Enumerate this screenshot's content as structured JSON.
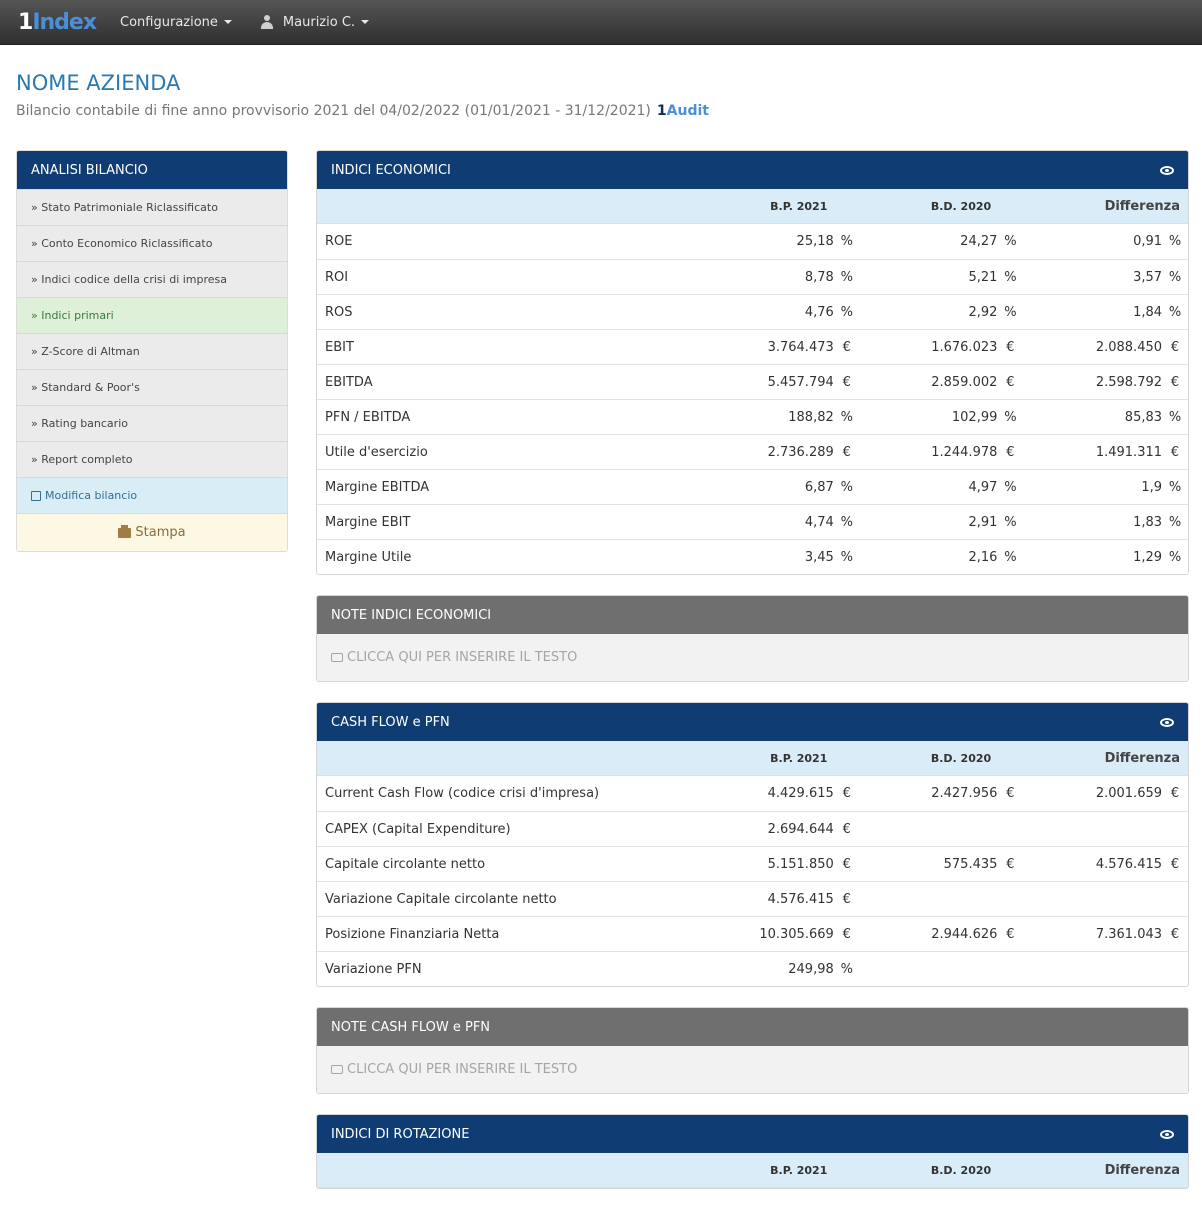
{
  "navbar": {
    "brand_one": "1",
    "brand_word": "Index",
    "config_label": "Configurazione",
    "user_label": "Maurizio C."
  },
  "header": {
    "company": "NOME AZIENDA",
    "subtitle": "Bilancio contabile di fine anno provvisorio 2021 del 04/02/2022 (01/01/2021 - 31/12/2021)",
    "audit_one": "1",
    "audit_word": "Audit"
  },
  "sidebar": {
    "title": "ANALISI BILANCIO",
    "items": [
      "» Stato Patrimoniale Riclassificato",
      "» Conto Economico Riclassificato",
      "» Indici codice della crisi di impresa",
      "» Indici primari",
      "» Z-Score di Altman",
      "» Standard & Poor's",
      "» Rating bancario",
      "» Report completo"
    ],
    "edit_label": "Modifica bilancio",
    "print_label": "Stampa"
  },
  "columns": {
    "bp": "B.P. 2021",
    "bd": "B.D. 2020",
    "diff": "Differenza"
  },
  "indici_economici": {
    "title": "INDICI ECONOMICI",
    "rows": [
      {
        "label": "ROE",
        "bp": "25,18",
        "bp_u": "%",
        "bd": "24,27",
        "bd_u": "%",
        "diff": "0,91",
        "diff_u": "%"
      },
      {
        "label": "ROI",
        "bp": "8,78",
        "bp_u": "%",
        "bd": "5,21",
        "bd_u": "%",
        "diff": "3,57",
        "diff_u": "%"
      },
      {
        "label": "ROS",
        "bp": "4,76",
        "bp_u": "%",
        "bd": "2,92",
        "bd_u": "%",
        "diff": "1,84",
        "diff_u": "%"
      },
      {
        "label": "EBIT",
        "bp": "3.764.473",
        "bp_u": "€",
        "bd": "1.676.023",
        "bd_u": "€",
        "diff": "2.088.450",
        "diff_u": "€"
      },
      {
        "label": "EBITDA",
        "bp": "5.457.794",
        "bp_u": "€",
        "bd": "2.859.002",
        "bd_u": "€",
        "diff": "2.598.792",
        "diff_u": "€"
      },
      {
        "label": "PFN / EBITDA",
        "bp": "188,82",
        "bp_u": "%",
        "bd": "102,99",
        "bd_u": "%",
        "diff": "85,83",
        "diff_u": "%"
      },
      {
        "label": "Utile d'esercizio",
        "bp": "2.736.289",
        "bp_u": "€",
        "bd": "1.244.978",
        "bd_u": "€",
        "diff": "1.491.311",
        "diff_u": "€"
      },
      {
        "label": "Margine EBITDA",
        "bp": "6,87",
        "bp_u": "%",
        "bd": "4,97",
        "bd_u": "%",
        "diff": "1,9",
        "diff_u": "%"
      },
      {
        "label": "Margine EBIT",
        "bp": "4,74",
        "bp_u": "%",
        "bd": "2,91",
        "bd_u": "%",
        "diff": "1,83",
        "diff_u": "%"
      },
      {
        "label": "Margine Utile",
        "bp": "3,45",
        "bp_u": "%",
        "bd": "2,16",
        "bd_u": "%",
        "diff": "1,29",
        "diff_u": "%"
      }
    ]
  },
  "note_economici": {
    "title": "NOTE INDICI ECONOMICI",
    "placeholder": "CLICCA QUI PER INSERIRE IL TESTO"
  },
  "cash_flow": {
    "title": "CASH FLOW e PFN",
    "rows": [
      {
        "label": "Current Cash Flow (codice crisi d'impresa)",
        "bp": "4.429.615",
        "bp_u": "€",
        "bd": "2.427.956",
        "bd_u": "€",
        "diff": "2.001.659",
        "diff_u": "€"
      },
      {
        "label": "CAPEX (Capital Expenditure)",
        "bp": "2.694.644",
        "bp_u": "€",
        "bd": "",
        "bd_u": "",
        "diff": "",
        "diff_u": ""
      },
      {
        "label": "Capitale circolante netto",
        "bp": "5.151.850",
        "bp_u": "€",
        "bd": "575.435",
        "bd_u": "€",
        "diff": "4.576.415",
        "diff_u": "€"
      },
      {
        "label": "Variazione Capitale circolante netto",
        "bp": "4.576.415",
        "bp_u": "€",
        "bd": "",
        "bd_u": "",
        "diff": "",
        "diff_u": ""
      },
      {
        "label": "Posizione Finanziaria Netta",
        "bp": "10.305.669",
        "bp_u": "€",
        "bd": "2.944.626",
        "bd_u": "€",
        "diff": "7.361.043",
        "diff_u": "€"
      },
      {
        "label": "Variazione PFN",
        "bp": "249,98",
        "bp_u": "%",
        "bd": "",
        "bd_u": "",
        "diff": "",
        "diff_u": ""
      }
    ]
  },
  "note_cash_flow": {
    "title": "NOTE CASH FLOW e PFN",
    "placeholder": "CLICCA QUI PER INSERIRE IL TESTO"
  },
  "indici_rotazione": {
    "title": "INDICI DI ROTAZIONE"
  }
}
